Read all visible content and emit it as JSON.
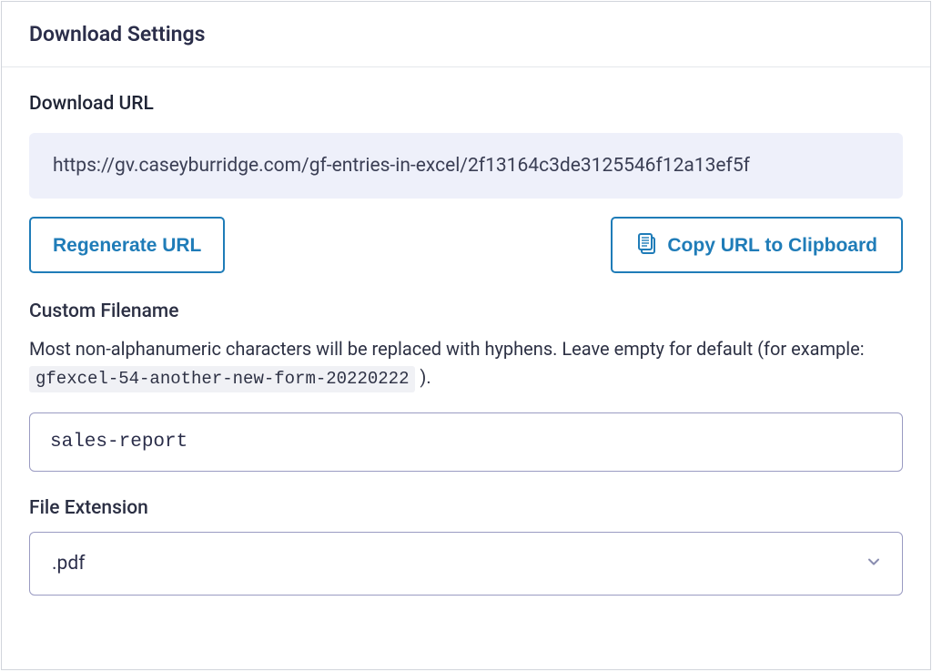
{
  "header": {
    "title": "Download Settings"
  },
  "download_url": {
    "label": "Download URL",
    "value": "https://gv.caseyburridge.com/gf-entries-in-excel/2f13164c3de3125546f12a13ef5f"
  },
  "buttons": {
    "regenerate": "Regenerate URL",
    "copy": "Copy URL to Clipboard"
  },
  "custom_filename": {
    "label": "Custom Filename",
    "help_prefix": "Most non-alphanumeric characters will be replaced with hyphens. Leave empty for default (for example: ",
    "help_example": "gfexcel-54-another-new-form-20220222",
    "help_suffix": " ).",
    "value": "sales-report"
  },
  "file_extension": {
    "label": "File Extension",
    "value": ".pdf"
  }
}
